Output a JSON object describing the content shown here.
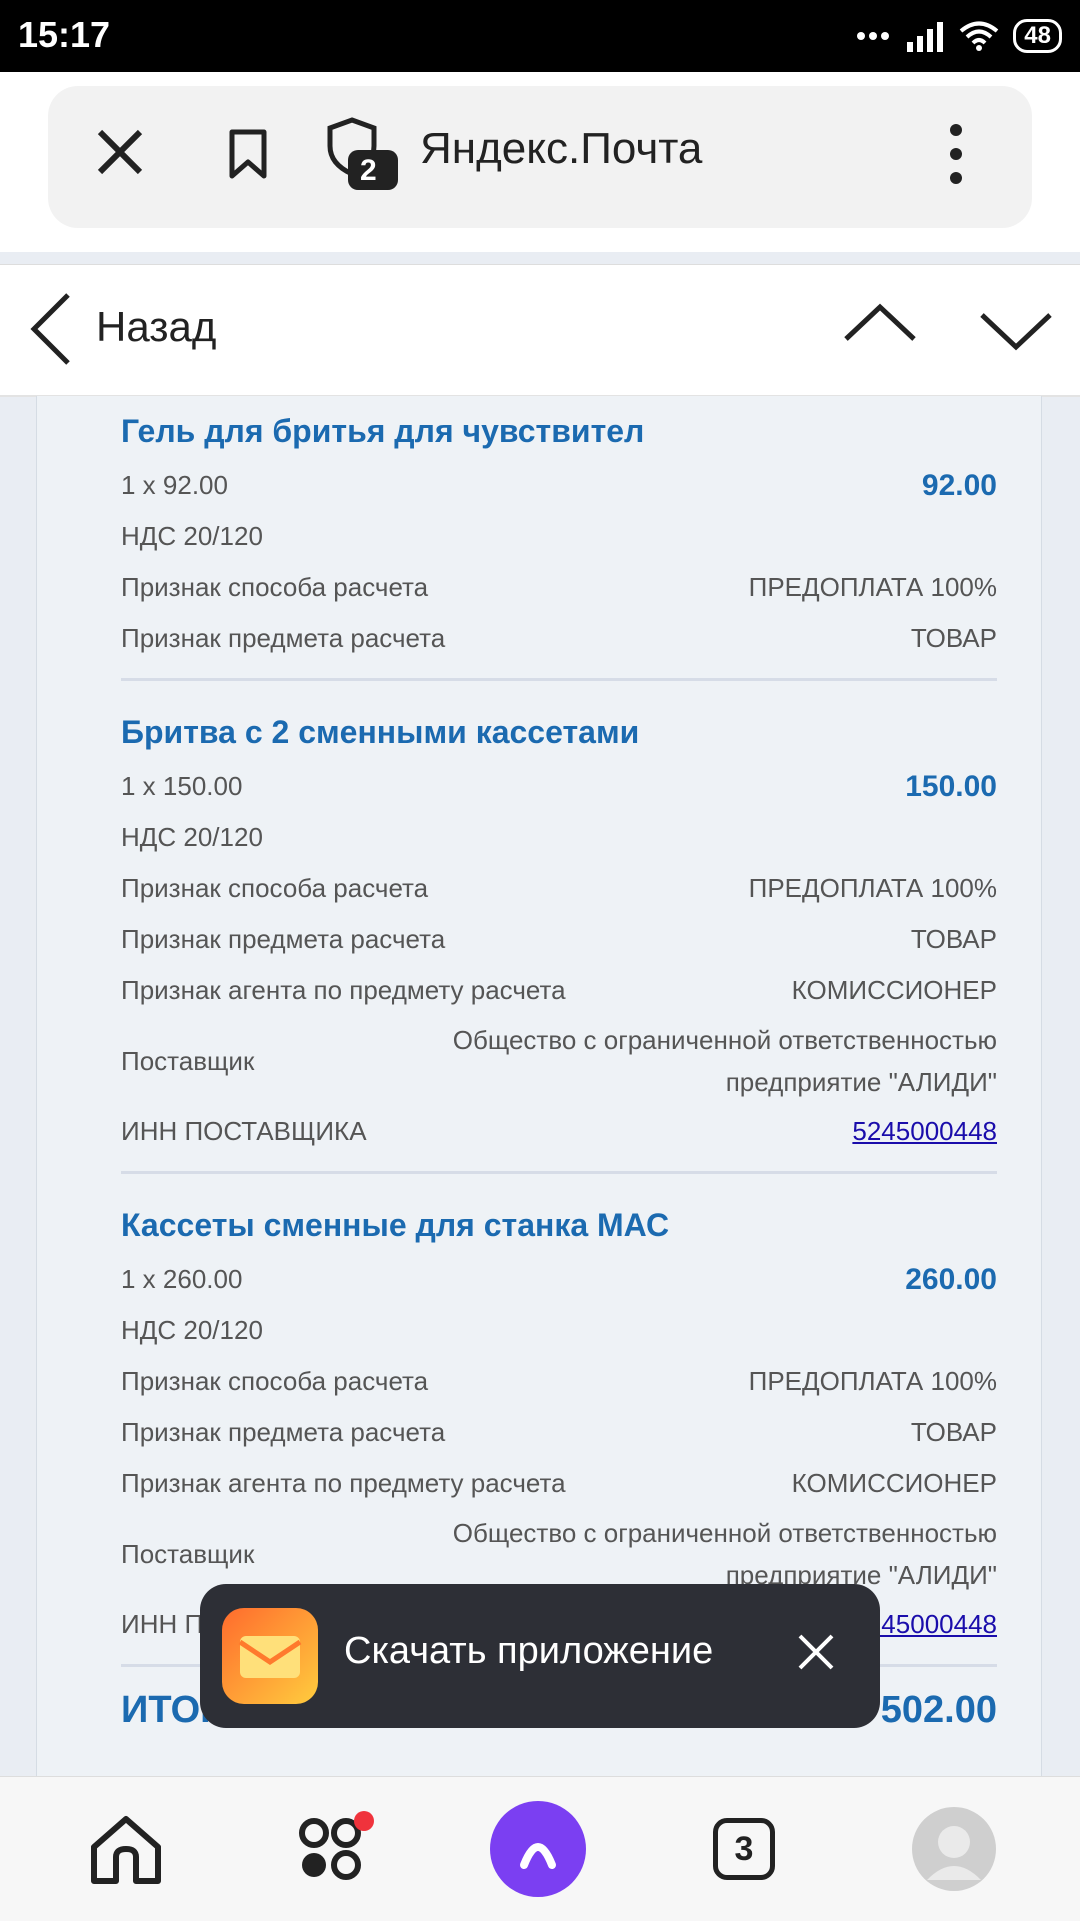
{
  "status_bar": {
    "time": "15:17",
    "battery": "48"
  },
  "browser": {
    "site_title": "Яндекс.Почта",
    "shield_count": "2"
  },
  "page_bar": {
    "back_label": "Назад"
  },
  "receipt": {
    "items": [
      {
        "title": "Гель для бритья для чувствител",
        "qty": "1 x 92.00",
        "sum": "92.00",
        "vat": "НДС 20/120",
        "pay_method_label": "Признак способа расчета",
        "pay_method_value": "ПРЕДОПЛАТА 100%",
        "subject_label": "Признак предмета расчета",
        "subject_value": "ТОВАР"
      },
      {
        "title": "Бритва с 2 сменными кассетами",
        "qty": "1 x 150.00",
        "sum": "150.00",
        "vat": "НДС 20/120",
        "pay_method_label": "Признак способа расчета",
        "pay_method_value": "ПРЕДОПЛАТА 100%",
        "subject_label": "Признак предмета расчета",
        "subject_value": "ТОВАР",
        "agent_label": "Признак агента по предмету расчета",
        "agent_value": "КОМИССИОНЕР",
        "supplier_label": "Поставщик",
        "supplier_line1": "Общество с ограниченной ответственностью",
        "supplier_line2": "предприятие \"АЛИДИ\"",
        "inn_label": "ИНН ПОСТАВЩИКА",
        "inn_value": "5245000448"
      },
      {
        "title": "Кассеты сменные для станка МАС",
        "qty": "1 x 260.00",
        "sum": "260.00",
        "vat": "НДС 20/120",
        "pay_method_label": "Признак способа расчета",
        "pay_method_value": "ПРЕДОПЛАТА 100%",
        "subject_label": "Признак предмета расчета",
        "subject_value": "ТОВАР",
        "agent_label": "Признак агента по предмету расчета",
        "agent_value": "КОМИССИОНЕР",
        "supplier_label": "Поставщик",
        "supplier_line1": "Общество с ограниченной ответственностью",
        "supplier_line2": "предприятие \"АЛИДИ\"",
        "inn_label": "ИНН ПОСТАВЩИКА",
        "inn_value": "5245000448"
      }
    ],
    "total_label": "ИТОГО:",
    "total_value": "502.00"
  },
  "toast": {
    "text": "Скачать приложение"
  },
  "bottom_nav": {
    "tab_count": "3"
  },
  "colors": {
    "accent": "#1b6ab0",
    "alice": "#7b3ff2",
    "notification_dot": "#f0333c"
  }
}
